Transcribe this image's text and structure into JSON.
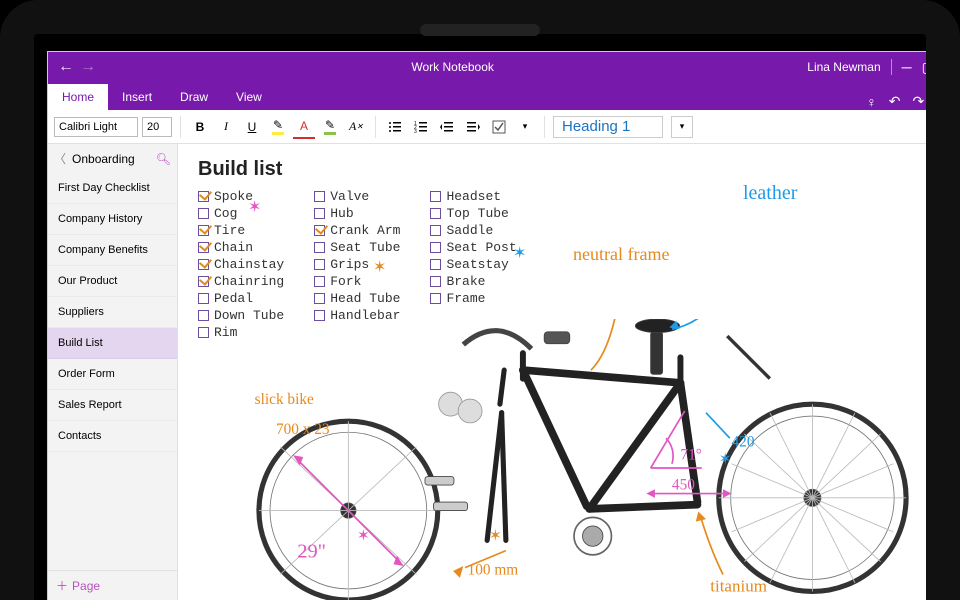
{
  "colors": {
    "brand": "#7719aa"
  },
  "titlebar": {
    "title": "Work Notebook",
    "user": "Lina Newman"
  },
  "tabs": [
    {
      "label": "Home",
      "active": true
    },
    {
      "label": "Insert",
      "active": false
    },
    {
      "label": "Draw",
      "active": false
    },
    {
      "label": "View",
      "active": false
    }
  ],
  "ribbon": {
    "font_name": "Calibri Light",
    "font_size": "20",
    "style_label": "Heading 1"
  },
  "sidebar": {
    "section": "Onboarding",
    "items": [
      "First Day Checklist",
      "Company History",
      "Company Benefits",
      "Our Product",
      "Suppliers",
      "Build List",
      "Order Form",
      "Sales Report",
      "Contacts"
    ],
    "active_index": 5,
    "add_page_label": "Page"
  },
  "page": {
    "title": "Build list",
    "columns": [
      [
        {
          "label": "Spoke",
          "checked": true
        },
        {
          "label": "Cog",
          "checked": false
        },
        {
          "label": "Tire",
          "checked": true
        },
        {
          "label": "Chain",
          "checked": true
        },
        {
          "label": "Chainstay",
          "checked": true
        },
        {
          "label": "Chainring",
          "checked": true
        },
        {
          "label": "Pedal",
          "checked": false
        },
        {
          "label": "Down Tube",
          "checked": false
        },
        {
          "label": "Rim",
          "checked": false
        }
      ],
      [
        {
          "label": "Valve",
          "checked": false
        },
        {
          "label": "Hub",
          "checked": false
        },
        {
          "label": "Crank Arm",
          "checked": true
        },
        {
          "label": "Seat Tube",
          "checked": false
        },
        {
          "label": "Grips",
          "checked": false
        },
        {
          "label": "Fork",
          "checked": false
        },
        {
          "label": "Head Tube",
          "checked": false
        },
        {
          "label": "Handlebar",
          "checked": false
        }
      ],
      [
        {
          "label": "Headset",
          "checked": false
        },
        {
          "label": "Top Tube",
          "checked": false
        },
        {
          "label": "Saddle",
          "checked": false
        },
        {
          "label": "Seat Post",
          "checked": false
        },
        {
          "label": "Seatstay",
          "checked": false
        },
        {
          "label": "Brake",
          "checked": false
        },
        {
          "label": "Frame",
          "checked": false
        }
      ]
    ],
    "annotations": {
      "slick_bike": "slick bike",
      "size": "700 x 23",
      "diameter": "29\"",
      "bb": "100 mm",
      "angle": "71°",
      "length": "450",
      "tube": "420",
      "neutral_frame": "neutral frame",
      "leather": "leather",
      "titanium": "titanium"
    }
  }
}
